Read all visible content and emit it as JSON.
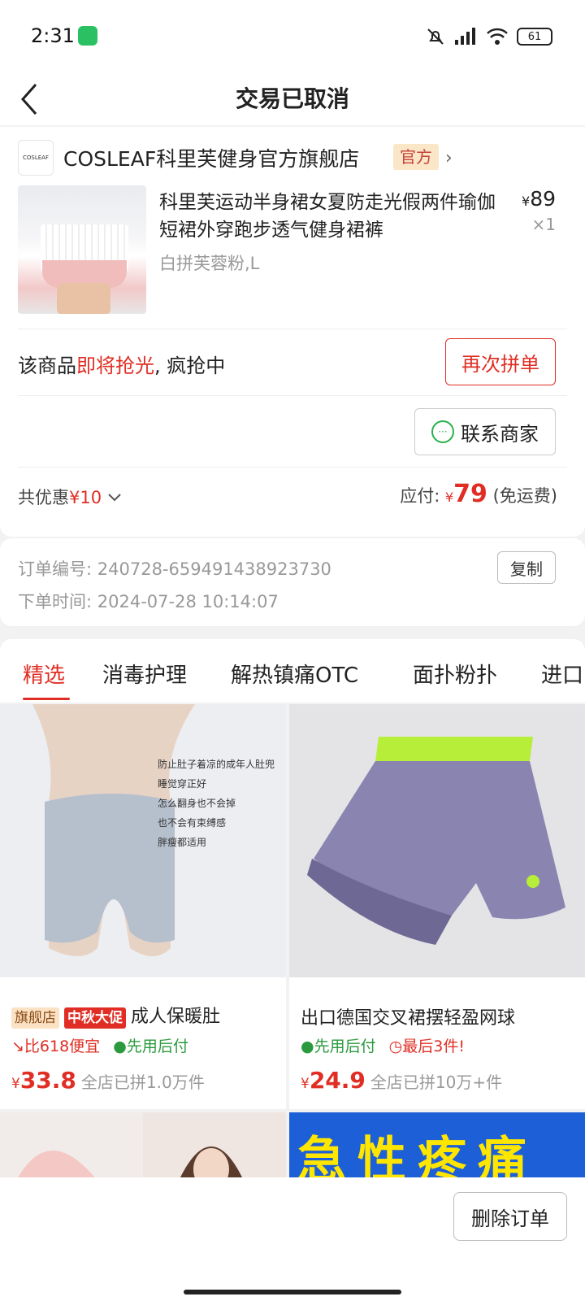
{
  "status_bar": {
    "time": "2:31",
    "battery": "61"
  },
  "nav": {
    "title": "交易已取消"
  },
  "store": {
    "name": "COSLEAF科里芙健身官方旗舰店",
    "badge": "官方",
    "logo_text": "COSLEAF"
  },
  "product": {
    "title": "科里芙运动半身裙女夏防走光假两件瑜伽短裙外穿跑步透气健身裙裤",
    "sku": "白拼芙蓉粉,L",
    "price_symbol": "¥",
    "price": "89",
    "qty": "×1"
  },
  "hint": {
    "prefix": "该商品",
    "highlight": "即将抢光",
    "suffix": ", 疯抢中"
  },
  "buttons": {
    "rebuy": "再次拼单",
    "contact": "联系商家",
    "copy": "复制",
    "delete": "删除订单"
  },
  "summary": {
    "discount_label": "共优惠",
    "discount_value": "¥10",
    "payable_label": "应付:",
    "payable_symbol": "¥",
    "payable_amount": "79",
    "shipping_note": "(免运费)"
  },
  "order_info": {
    "number_label": "订单编号:",
    "number": "240728-659491438923730",
    "time_label": "下单时间:",
    "time": "2024-07-28 10:14:07"
  },
  "tabs": [
    "精选",
    "消毒护理",
    "解热镇痛OTC",
    "面扑粉扑",
    "进口"
  ],
  "recommendations": [
    {
      "tags": [
        "旗舰店",
        "中秋大促"
      ],
      "title": "成人保暖肚",
      "badges": [
        "比618便宜",
        "先用后付"
      ],
      "price_symbol": "¥",
      "price": "33.8",
      "sold": "全店已拼1.0万件",
      "image_lines": [
        "防止肚子着凉的成年人肚兜",
        "睡觉穿正好",
        "怎么翻身也不会掉",
        "也不会有束缚感",
        "胖瘦都适用"
      ]
    },
    {
      "title": "出口德国交叉裙摆轻盈网球",
      "badges": [
        "先用后付",
        "最后3件!"
      ],
      "price_symbol": "¥",
      "price": "24.9",
      "sold": "全店已拼10万+件"
    }
  ],
  "banner_text": "急性疼痛",
  "colors": {
    "accent": "#e02e24",
    "green": "#2b9a3e",
    "badge_bg": "#fbe6c8"
  }
}
